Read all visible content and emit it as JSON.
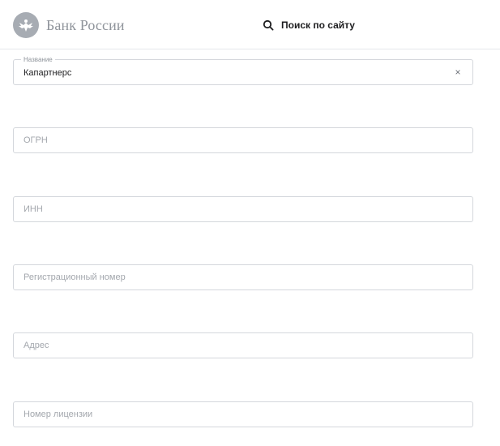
{
  "header": {
    "logo_text": "Банк России",
    "search_label": "Поиск по сайту"
  },
  "form": {
    "name": {
      "label": "Название",
      "value": "Капартнерс",
      "clear": "×"
    },
    "ogrn": {
      "placeholder": "ОГРН"
    },
    "inn": {
      "placeholder": "ИНН"
    },
    "reg_number": {
      "placeholder": "Регистрационный номер"
    },
    "address": {
      "placeholder": "Адрес"
    },
    "license": {
      "placeholder": "Номер лицензии"
    }
  },
  "colors": {
    "text": "#1d1d1f",
    "muted": "#8f949b",
    "placeholder": "#a3a7ad",
    "border": "#d4d7dc"
  }
}
